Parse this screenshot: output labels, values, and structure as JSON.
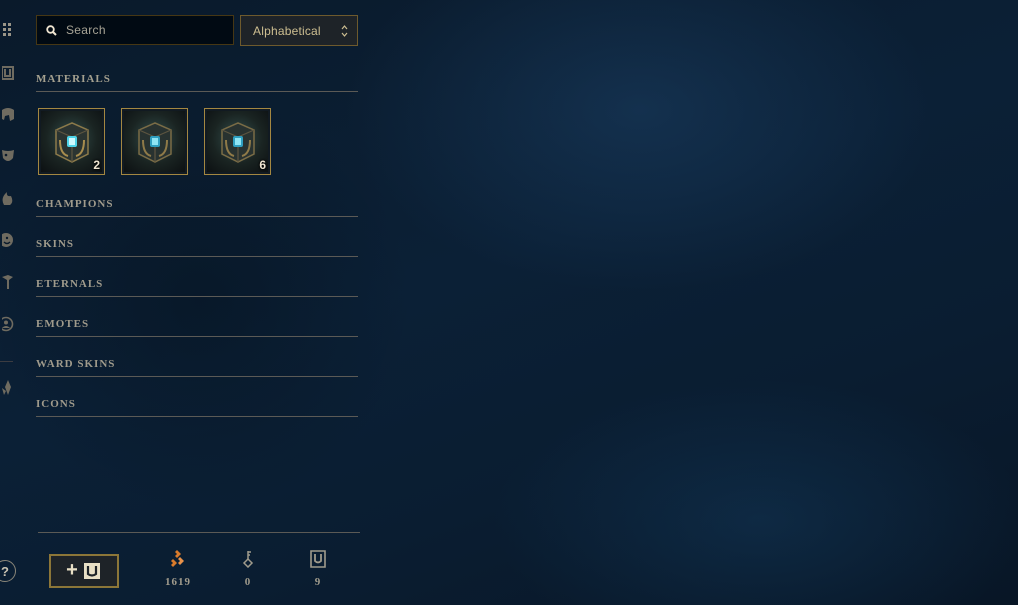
{
  "search": {
    "placeholder": "Search"
  },
  "sort": {
    "selected": "Alphabetical"
  },
  "sections": [
    {
      "title": "MATERIALS"
    },
    {
      "title": "CHAMPIONS"
    },
    {
      "title": "SKINS"
    },
    {
      "title": "ETERNALS"
    },
    {
      "title": "EMOTES"
    },
    {
      "title": "WARD SKINS"
    },
    {
      "title": "ICONS"
    }
  ],
  "materials": [
    {
      "icon": "hextech-chest-icon",
      "count": "2"
    },
    {
      "icon": "hextech-chest-icon",
      "count": ""
    },
    {
      "icon": "hextech-chest-icon",
      "count": "6"
    }
  ],
  "footer": {
    "craft_button_icon": "add-chest-icon",
    "blue_essence": "1619",
    "keys": "0",
    "chests": "9"
  },
  "rail": {
    "help_label": "?"
  },
  "colors": {
    "gold": "#c8aa6e",
    "orange_essence": "#d97b2b",
    "accent_blue": "#0ac8b9"
  }
}
